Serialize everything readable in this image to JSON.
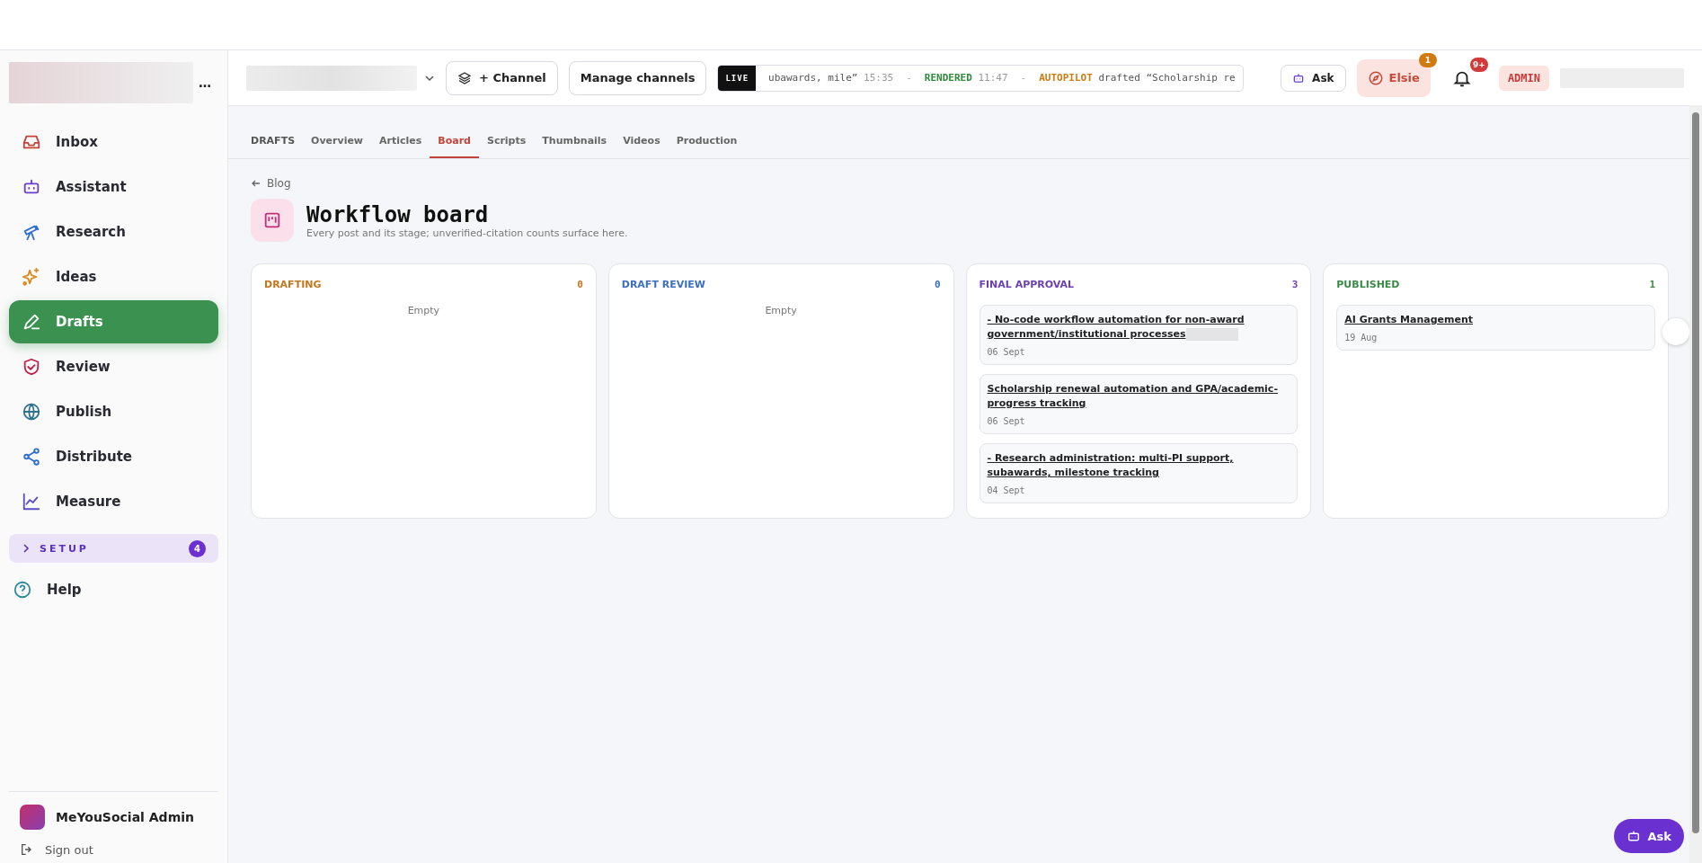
{
  "sidebar": {
    "items": [
      {
        "label": "Inbox",
        "selected": false
      },
      {
        "label": "Assistant",
        "selected": false
      },
      {
        "label": "Research",
        "selected": false
      },
      {
        "label": "Ideas",
        "selected": false
      },
      {
        "label": "Drafts",
        "selected": true
      },
      {
        "label": "Review",
        "selected": false
      },
      {
        "label": "Publish",
        "selected": false
      },
      {
        "label": "Distribute",
        "selected": false
      },
      {
        "label": "Measure",
        "selected": false
      }
    ],
    "more": "…",
    "setup": {
      "label": "SETUP",
      "count": "4",
      "expanded": false
    },
    "help": "Help",
    "user": "MeYouSocial Admin",
    "sign_out": "Sign out"
  },
  "header": {
    "channel_button": "+ Channel",
    "manage_button": "Manage channels",
    "ticker": {
      "badge": "LIVE",
      "separator": "-",
      "events": [
        {
          "kind": "text",
          "text": "ubawards, mile”",
          "time": "15:35"
        },
        {
          "kind": "tagged",
          "tag": "RENDERED",
          "color": "#2f8a3c",
          "time": "11:47"
        },
        {
          "kind": "tagged",
          "tag": "AUTOPILOT",
          "color": "#d07a10",
          "text": "drafted “Scholarship re"
        }
      ]
    },
    "ask": "Ask",
    "elsie": {
      "label": "Elsie",
      "badge": "1"
    },
    "notifications": "9+",
    "role": "ADMIN"
  },
  "tabs": [
    {
      "label": "DRAFTS",
      "kind": "section",
      "selected": false
    },
    {
      "label": "Overview",
      "kind": "tab",
      "selected": false
    },
    {
      "label": "Articles",
      "kind": "tab",
      "selected": false
    },
    {
      "label": "Board",
      "kind": "tab",
      "selected": true
    },
    {
      "label": "Scripts",
      "kind": "tab",
      "selected": false
    },
    {
      "label": "Thumbnails",
      "kind": "tab",
      "selected": false
    },
    {
      "label": "Videos",
      "kind": "tab",
      "selected": false
    },
    {
      "label": "Production",
      "kind": "tab",
      "selected": false
    }
  ],
  "back_link": "Blog",
  "title": "Workflow board",
  "subtitle": "Every post and its stage; unverified-citation counts surface here.",
  "columns": [
    {
      "title": "DRAFTING",
      "color": "#c4761c",
      "count": "0",
      "empty": "Empty"
    },
    {
      "title": "DRAFT REVIEW",
      "color": "#3d6fbf",
      "count": "0",
      "empty": "Empty"
    },
    {
      "title": "FINAL APPROVAL",
      "color": "#6a3fb5",
      "count": "3",
      "cards": [
        {
          "title": "- No-code workflow automation for non-award government/institutional processes",
          "date": "06 Sept",
          "redacted": true
        },
        {
          "title": "Scholarship renewal automation and GPA/academic-progress tracking",
          "date": "06 Sept",
          "redacted": false
        },
        {
          "title": "- Research administration: multi-PI support, subawards, milestone tracking",
          "date": "04 Sept",
          "redacted": false
        }
      ]
    },
    {
      "title": "PUBLISHED",
      "color": "#3a8a45",
      "count": "1",
      "cards": [
        {
          "title": "AI Grants Management",
          "date": "19 Aug",
          "redacted": false
        }
      ]
    }
  ],
  "fab": "Ask"
}
